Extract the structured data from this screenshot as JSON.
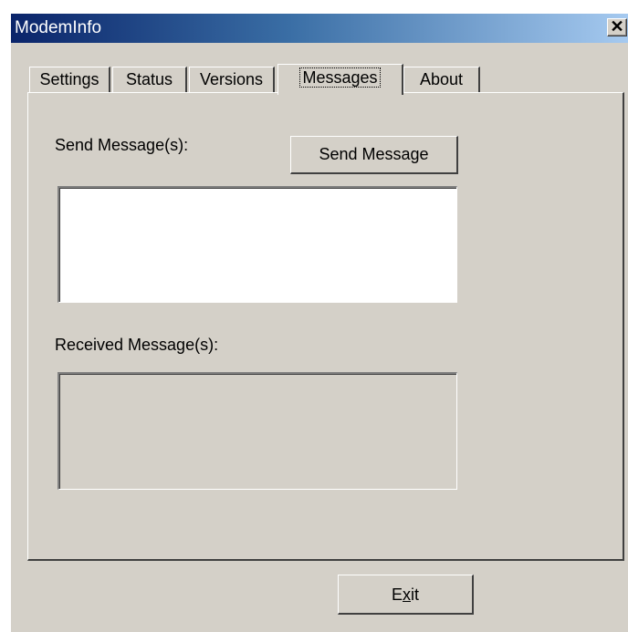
{
  "window": {
    "title": "ModemInfo",
    "close_glyph": "✕"
  },
  "tabs": [
    {
      "label": "Settings"
    },
    {
      "label": "Status"
    },
    {
      "label": "Versions"
    },
    {
      "label": "Messages",
      "active": true
    },
    {
      "label": "About"
    }
  ],
  "messages": {
    "send_label": "Send Message(s):",
    "send_button": "Send Message",
    "send_value": "",
    "received_label": "Received Message(s):",
    "received_value": ""
  },
  "footer": {
    "exit_prefix": "E",
    "exit_accel": "x",
    "exit_suffix": "it"
  }
}
